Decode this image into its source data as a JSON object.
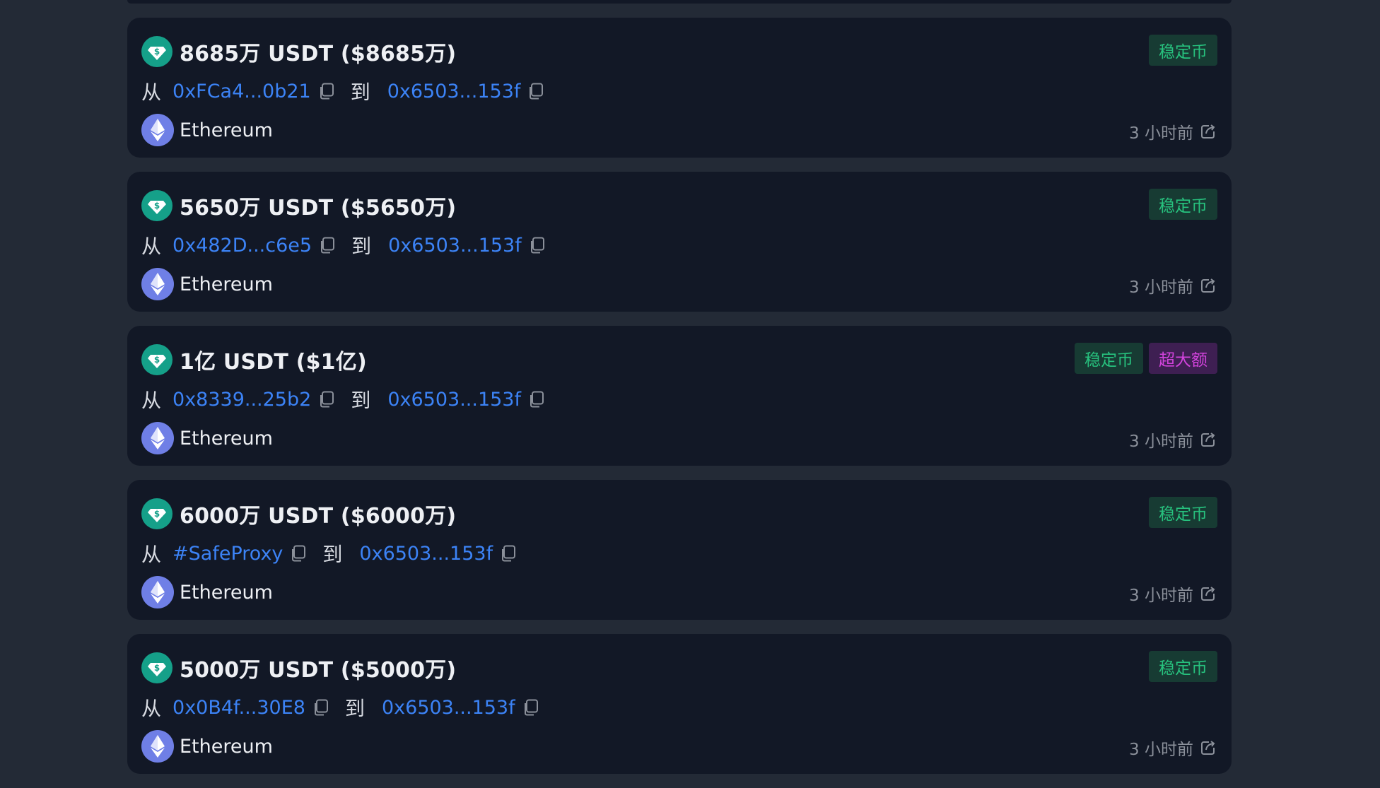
{
  "colors": {
    "page_bg": "#232a36",
    "card_bg": "#121826",
    "address_link": "#3c83f6",
    "stable_tag_text": "#27c27e",
    "huge_tag_text": "#d243dc",
    "usdt_icon": "#15a089",
    "eth_icon": "#6f7fe6"
  },
  "labels": {
    "from": "从",
    "to": "到"
  },
  "transfers": [
    {
      "title": "8685万 USDT ($8685万)",
      "token_icon": "usdt-icon",
      "from": "0xFCa4...0b21",
      "to": "0x6503...153f",
      "chain": "Ethereum",
      "chain_icon": "ethereum-icon",
      "tags": [
        "稳定币"
      ],
      "time": "3 小时前"
    },
    {
      "title": "5650万 USDT ($5650万)",
      "token_icon": "usdt-icon",
      "from": "0x482D...c6e5",
      "to": "0x6503...153f",
      "chain": "Ethereum",
      "chain_icon": "ethereum-icon",
      "tags": [
        "稳定币"
      ],
      "time": "3 小时前"
    },
    {
      "title": "1亿 USDT ($1亿)",
      "token_icon": "usdt-icon",
      "from": "0x8339...25b2",
      "to": "0x6503...153f",
      "chain": "Ethereum",
      "chain_icon": "ethereum-icon",
      "tags": [
        "稳定币",
        "超大额"
      ],
      "time": "3 小时前"
    },
    {
      "title": "6000万 USDT ($6000万)",
      "token_icon": "usdt-icon",
      "from": "#SafeProxy",
      "to": "0x6503...153f",
      "chain": "Ethereum",
      "chain_icon": "ethereum-icon",
      "tags": [
        "稳定币"
      ],
      "time": "3 小时前"
    },
    {
      "title": "5000万 USDT ($5000万)",
      "token_icon": "usdt-icon",
      "from": "0x0B4f...30E8",
      "to": "0x6503...153f",
      "chain": "Ethereum",
      "chain_icon": "ethereum-icon",
      "tags": [
        "稳定币"
      ],
      "time": "3 小时前"
    }
  ]
}
